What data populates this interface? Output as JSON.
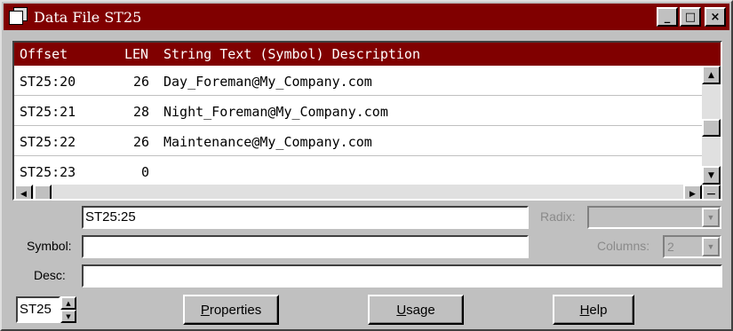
{
  "window": {
    "title": "Data File ST25",
    "buttons": {
      "minimize": "_",
      "maximize": "□",
      "close": "×"
    }
  },
  "grid": {
    "columns": {
      "offset": "Offset",
      "len": "LEN",
      "string": "String Text  (Symbol) Description"
    },
    "rows": [
      {
        "offset": "ST25:20",
        "len": "26",
        "text": "Day_Foreman@My_Company.com"
      },
      {
        "offset": "ST25:21",
        "len": "28",
        "text": "Night_Foreman@My_Company.com"
      },
      {
        "offset": "ST25:22",
        "len": "26",
        "text": "Maintenance@My_Company.com"
      },
      {
        "offset": "ST25:23",
        "len": "0",
        "text": ""
      }
    ]
  },
  "form": {
    "address_value": "ST25:25",
    "symbol_label": "Symbol:",
    "symbol_value": "",
    "desc_label": "Desc:",
    "desc_value": "",
    "radix_label": "Radix:",
    "radix_value": "",
    "columns_label": "Columns:",
    "columns_value": "2",
    "file_value": "ST25"
  },
  "buttons": {
    "properties": {
      "hotkey": "P",
      "rest": "roperties"
    },
    "usage": {
      "hotkey": "U",
      "rest": "sage"
    },
    "help": {
      "hotkey": "H",
      "rest": "elp"
    }
  },
  "colors": {
    "titlebar": "#800000",
    "face": "#c0c0c0"
  }
}
